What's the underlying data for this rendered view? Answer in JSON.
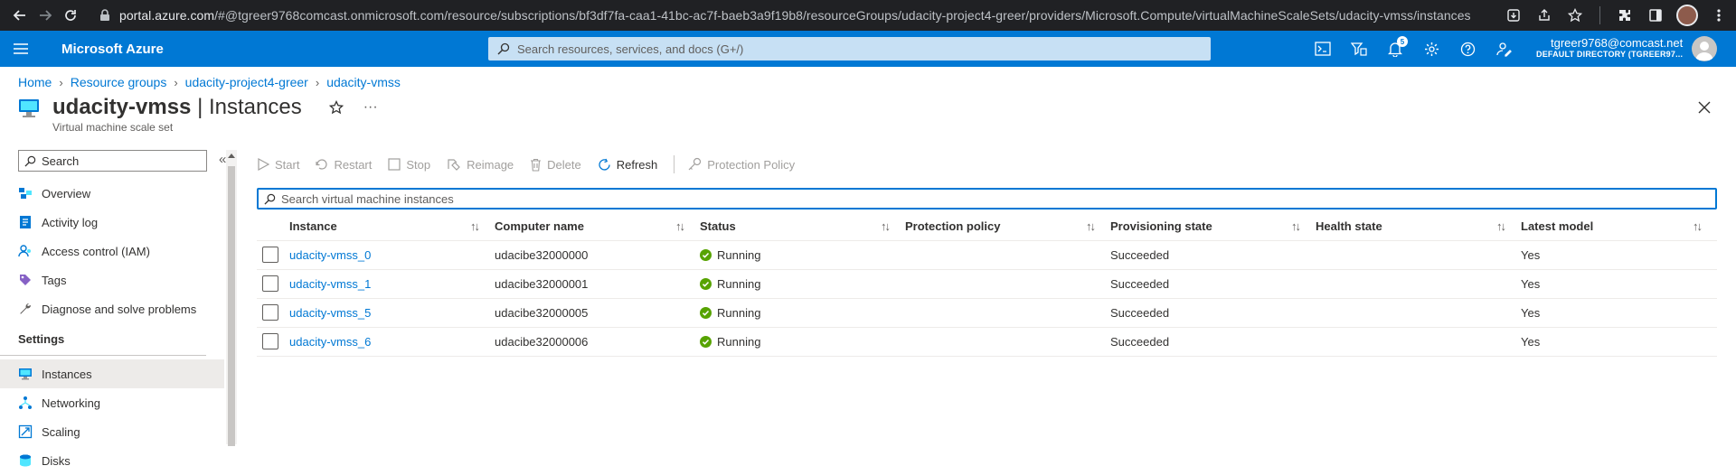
{
  "browser": {
    "url_host": "portal.azure.com",
    "url_path": "/#@tgreer9768comcast.onmicrosoft.com/resource/subscriptions/bf3df7fa-caa1-41bc-ac7f-baeb3a9f19b8/resourceGroups/udacity-project4-greer/providers/Microsoft.Compute/virtualMachineScaleSets/udacity-vmss/instances"
  },
  "header": {
    "brand": "Microsoft Azure",
    "search_placeholder": "Search resources, services, and docs (G+/)",
    "notification_count": "5",
    "user": "tgreer9768@comcast.net",
    "directory": "DEFAULT DIRECTORY (TGREER97..."
  },
  "breadcrumb": [
    "Home",
    "Resource groups",
    "udacity-project4-greer",
    "udacity-vmss"
  ],
  "page": {
    "resource_name": "udacity-vmss",
    "separator": " | ",
    "blade_name": "Instances",
    "subtitle": "Virtual machine scale set",
    "more": "···"
  },
  "leftnav": {
    "search_placeholder": "Search",
    "collapse": "«",
    "items_top": [
      {
        "label": "Overview",
        "icon": "overview-icon"
      },
      {
        "label": "Activity log",
        "icon": "activity-log-icon"
      },
      {
        "label": "Access control (IAM)",
        "icon": "iam-icon"
      },
      {
        "label": "Tags",
        "icon": "tag-icon"
      },
      {
        "label": "Diagnose and solve problems",
        "icon": "wrench-icon"
      }
    ],
    "section": "Settings",
    "items_settings": [
      {
        "label": "Instances",
        "icon": "vm-icon"
      },
      {
        "label": "Networking",
        "icon": "network-icon"
      },
      {
        "label": "Scaling",
        "icon": "scaling-icon"
      },
      {
        "label": "Disks",
        "icon": "disks-icon"
      }
    ]
  },
  "toolbar": {
    "start": "Start",
    "restart": "Restart",
    "stop": "Stop",
    "reimage": "Reimage",
    "delete": "Delete",
    "refresh": "Refresh",
    "protection_policy": "Protection Policy"
  },
  "instances_search_placeholder": "Search virtual machine instances",
  "table": {
    "columns": [
      "Instance",
      "Computer name",
      "Status",
      "Protection policy",
      "Provisioning state",
      "Health state",
      "Latest model"
    ],
    "rows": [
      {
        "instance": "udacity-vmss_0",
        "computer": "udacibe32000000",
        "status": "Running",
        "protection": "",
        "provisioning": "Succeeded",
        "health": "",
        "latest": "Yes"
      },
      {
        "instance": "udacity-vmss_1",
        "computer": "udacibe32000001",
        "status": "Running",
        "protection": "",
        "provisioning": "Succeeded",
        "health": "",
        "latest": "Yes"
      },
      {
        "instance": "udacity-vmss_5",
        "computer": "udacibe32000005",
        "status": "Running",
        "protection": "",
        "provisioning": "Succeeded",
        "health": "",
        "latest": "Yes"
      },
      {
        "instance": "udacity-vmss_6",
        "computer": "udacibe32000006",
        "status": "Running",
        "protection": "",
        "provisioning": "Succeeded",
        "health": "",
        "latest": "Yes"
      }
    ]
  },
  "colors": {
    "azure_blue": "#0078d4",
    "status_green": "#57a300"
  }
}
